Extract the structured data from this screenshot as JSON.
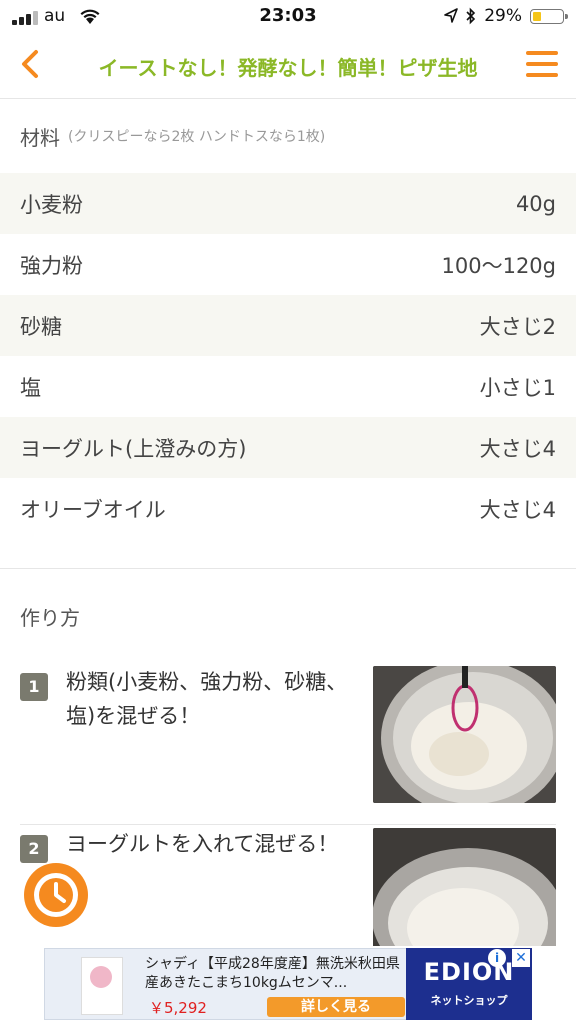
{
  "status_bar": {
    "carrier": "au",
    "time": "23:03",
    "battery_pct": "29%",
    "battery_level": 0.29,
    "battery_color": "#f5c518"
  },
  "navbar": {
    "title": "イーストなし！発酵なし！簡単！ピザ生地",
    "title_color": "#8bb827",
    "accent_color": "#f58a1f",
    "back_icon": "chevron-left-icon",
    "menu_icon": "hamburger-menu-icon"
  },
  "ingredients": {
    "heading": "材料",
    "note": "(クリスピーなら2枚 ハンドトスなら1枚)",
    "items": [
      {
        "name": "小麦粉",
        "amount": "40g"
      },
      {
        "name": "強力粉",
        "amount": "100〜120g"
      },
      {
        "name": "砂糖",
        "amount": "大さじ2"
      },
      {
        "name": "塩",
        "amount": "小さじ1"
      },
      {
        "name": "ヨーグルト(上澄みの方)",
        "amount": "大さじ4"
      },
      {
        "name": "オリーブオイル",
        "amount": "大さじ4"
      }
    ]
  },
  "steps": {
    "heading": "作り方",
    "items": [
      {
        "number": "1",
        "text": "粉類(小麦粉、強力粉、砂糖、塩)を混ぜる！"
      },
      {
        "number": "2",
        "text": "ヨーグルトを入れて混ぜる！"
      }
    ]
  },
  "timer": {
    "icon": "clock-icon"
  },
  "ad": {
    "title": "シャディ【平成28年度産】無洗米秋田県産あきたこまち10kgムセンマ...",
    "price": "￥5,292",
    "cta": "詳しく見る",
    "logo_main": "EDION",
    "logo_sub": "ネットショップ",
    "info_icon": "info-icon",
    "close_icon": "close-icon"
  }
}
